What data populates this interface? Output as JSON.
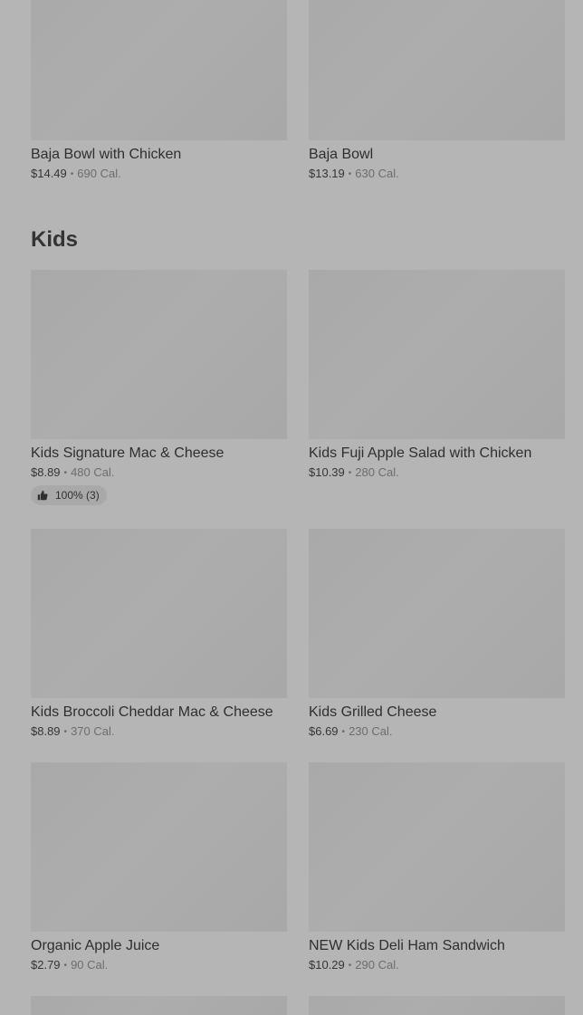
{
  "items_top": [
    {
      "name": "Baja Bowl with Chicken",
      "price": "$14.49",
      "sep": "•",
      "calories": "690 Cal."
    },
    {
      "name": "Baja Bowl",
      "price": "$13.19",
      "sep": "•",
      "calories": "630 Cal."
    }
  ],
  "kids": {
    "title": "Kids",
    "items": [
      {
        "name": "Kids Signature Mac & Cheese",
        "price": "$8.89",
        "sep": "•",
        "calories": "480 Cal.",
        "rating": "100% (3)"
      },
      {
        "name": "Kids Fuji Apple Salad with Chicken",
        "price": "$10.39",
        "sep": "•",
        "calories": "280 Cal."
      },
      {
        "name": "Kids Broccoli Cheddar Mac & Cheese",
        "price": "$8.89",
        "sep": "•",
        "calories": "370 Cal."
      },
      {
        "name": "Kids Grilled Cheese",
        "price": "$6.69",
        "sep": "•",
        "calories": "230 Cal."
      },
      {
        "name": "Organic Apple Juice",
        "price": "$2.79",
        "sep": "•",
        "calories": "90 Cal."
      },
      {
        "name": "NEW Kids Deli Ham Sandwich",
        "price": "$10.29",
        "sep": "•",
        "calories": "290 Cal."
      }
    ]
  },
  "icons": {
    "rating": "thumbs-up-icon"
  }
}
